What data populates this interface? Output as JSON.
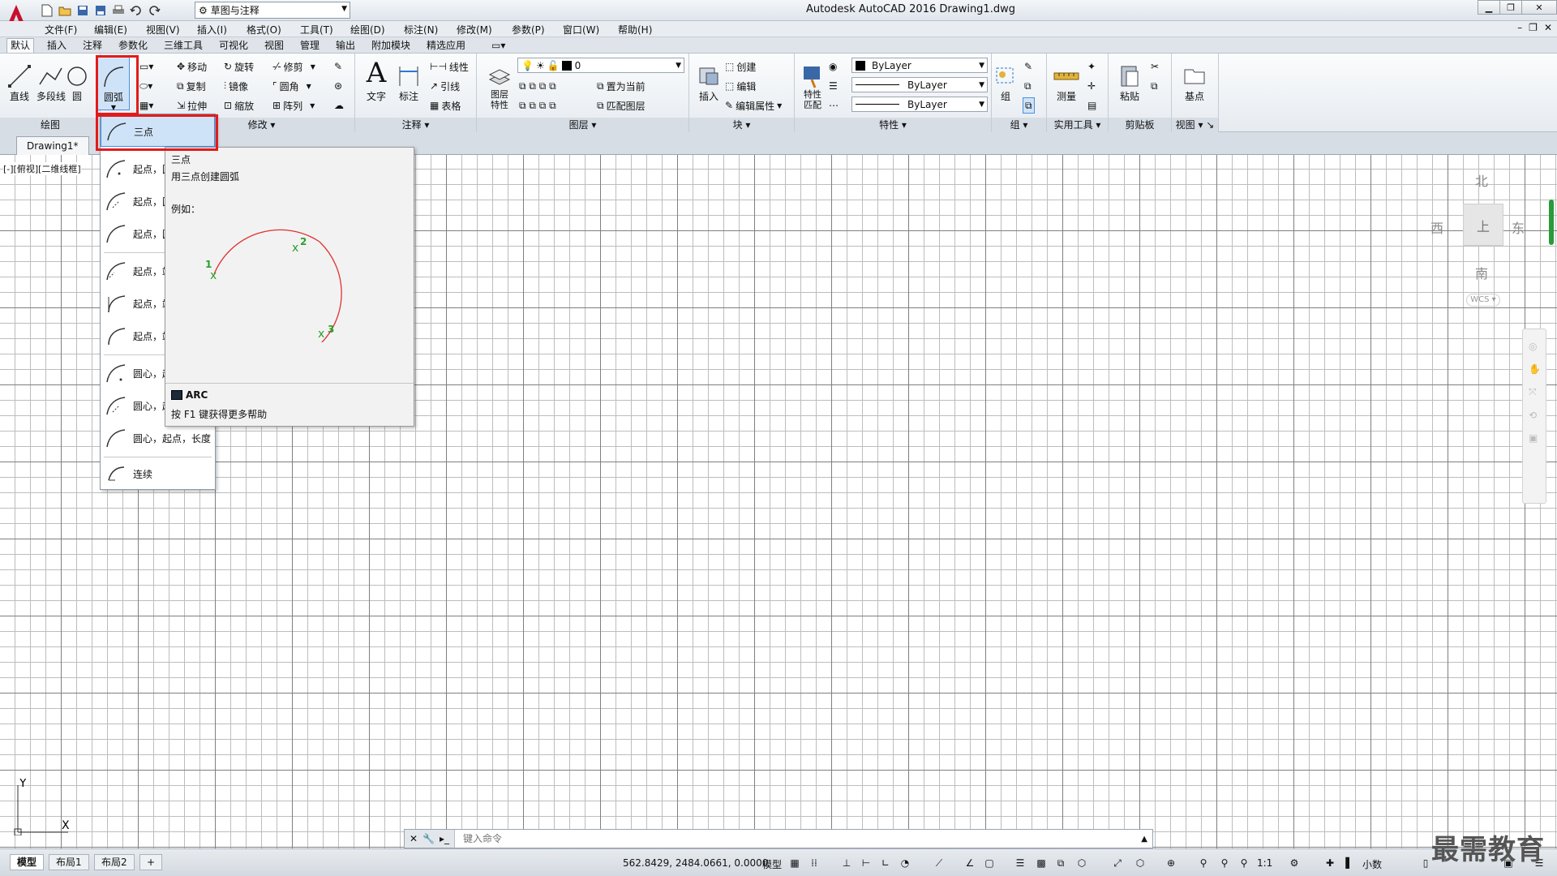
{
  "titlebar": {
    "workspace": "草图与注释",
    "window_title": "Autodesk AutoCAD 2016    Drawing1.dwg"
  },
  "menubar": {
    "items": [
      "文件(F)",
      "编辑(E)",
      "视图(V)",
      "插入(I)",
      "格式(O)",
      "工具(T)",
      "绘图(D)",
      "标注(N)",
      "修改(M)",
      "参数(P)",
      "窗口(W)",
      "帮助(H)"
    ]
  },
  "ribbon_tabs": [
    "默认",
    "插入",
    "注释",
    "参数化",
    "三维工具",
    "可视化",
    "视图",
    "管理",
    "输出",
    "附加模块",
    "精选应用"
  ],
  "ribbon": {
    "draw": {
      "title": "绘图",
      "line": "直线",
      "polyline": "多段线",
      "circle": "圆",
      "arc": "圆弧"
    },
    "modify": {
      "title": "修改",
      "move": "移动",
      "rotate": "旋转",
      "trim": "修剪",
      "copy": "复制",
      "mirror": "镜像",
      "fillet": "圆角",
      "stretch": "拉伸",
      "scale": "缩放",
      "array": "阵列"
    },
    "annotation": {
      "title": "注释",
      "text": "文字",
      "dimension": "标注",
      "linear": "线性",
      "leader": "引线",
      "table": "表格"
    },
    "layers": {
      "title": "图层",
      "properties": "图层特性",
      "current_layer": "0",
      "set_current": "置为当前",
      "match_layer": "匹配图层"
    },
    "block": {
      "title": "块",
      "insert": "插入",
      "create": "创建",
      "edit": "编辑",
      "edit_attr": "编辑属性"
    },
    "properties": {
      "title": "特性",
      "match": "特性匹配",
      "color": "ByLayer",
      "linetype": "ByLayer",
      "lineweight": "ByLayer"
    },
    "groups": {
      "title": "组",
      "group": "组"
    },
    "utilities": {
      "title": "实用工具",
      "measure": "测量"
    },
    "clipboard": {
      "title": "剪贴板",
      "paste": "粘贴"
    },
    "view": {
      "title": "视图",
      "base": "基点"
    }
  },
  "doc_tab": "Drawing1*",
  "viewport_label": "[-][俯视][二维线框]",
  "arc_menu": {
    "items": [
      "三点",
      "起点，圆心，端点",
      "起点，圆心，角度",
      "起点，圆心，长度",
      "起点，端点，角度",
      "起点，端点，方向",
      "起点，端点，半径",
      "圆心，起点，端点",
      "圆心，起点，角度",
      "圆心，起点，长度",
      "连续"
    ]
  },
  "tooltip": {
    "title": "三点",
    "description": "用三点创建圆弧",
    "example_label": "例如：",
    "point_labels": [
      "1",
      "2",
      "3"
    ],
    "command": "ARC",
    "help": "按 F1 键获得更多帮助"
  },
  "viewcube": {
    "north": "北",
    "south": "南",
    "east": "东",
    "west": "西",
    "top": "上",
    "wcs": "WCS"
  },
  "ucs": {
    "x": "X",
    "y": "Y"
  },
  "command_line": {
    "placeholder": "键入命令"
  },
  "layout_tabs": [
    "模型",
    "布局1",
    "布局2"
  ],
  "status": {
    "coordinates": "562.8429, 2484.0661, 0.0000",
    "model": "模型",
    "scale": "1:1",
    "units": "小数"
  },
  "watermark": "最需教育",
  "colors": {
    "highlight": "#e21b1b",
    "arc": "#e03030",
    "points": "#2aa02a",
    "selection": "#cfe3f8"
  }
}
